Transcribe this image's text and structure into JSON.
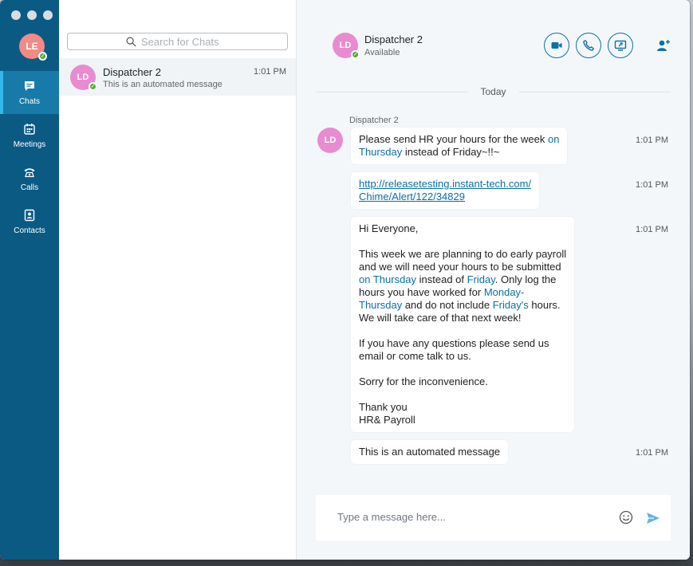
{
  "colors": {
    "rail": "#0a5a84",
    "rail_active": "#187aa8",
    "accent": "#0b72a3",
    "link": "#0b6fa4",
    "presence": "#4caf2f"
  },
  "me": {
    "initials": "LE"
  },
  "nav": {
    "items": [
      {
        "label": "Chats",
        "icon": "chat-icon"
      },
      {
        "label": "Meetings",
        "icon": "calendar-icon"
      },
      {
        "label": "Calls",
        "icon": "phone-icon"
      },
      {
        "label": "Contacts",
        "icon": "contacts-icon"
      }
    ]
  },
  "search": {
    "placeholder": "Search for Chats",
    "icon": "search-icon"
  },
  "chat_list": [
    {
      "initials": "LD",
      "name": "Dispatcher 2",
      "preview": "This is an automated message",
      "time": "1:01 PM"
    }
  ],
  "conversation": {
    "initials": "LD",
    "name": "Dispatcher 2",
    "status": "Available",
    "actions": [
      "video-icon",
      "phone-icon",
      "screen-share-icon",
      "add-person-icon"
    ],
    "date_divider": "Today",
    "sender": "Dispatcher 2",
    "messages": [
      {
        "time": "1:01 PM",
        "line1_a": "Please send HR your hours for the week ",
        "line1_b": "on",
        "line2_a": "Thursday",
        "line2_b": " instead of Friday~!!~"
      },
      {
        "time": "1:01 PM",
        "link_line1": "http://releasetesting.instant-tech.com/",
        "link_line2": "Chime/Alert/122/34829"
      },
      {
        "time": "1:01 PM",
        "greeting": "Hi Everyone,",
        "p1_l1": "This week we are planning to do early payroll",
        "p1_l2": "and we will need your hours to be submitted",
        "p1_l3a": "on Thursday",
        "p1_l3b": " instead of ",
        "p1_l3c": "Friday",
        "p1_l3d": ". Only log the",
        "p1_l4a": "hours you have worked for ",
        "p1_l4b": "Monday-",
        "p1_l5a": "Thursday",
        "p1_l5b": " and do not include ",
        "p1_l5c": "Friday's",
        "p1_l5d": " hours.",
        "p1_l6": "We will take care of that next week!",
        "p2_l1": "If you have any questions please send us",
        "p2_l2": "email or come talk to us.",
        "p3": "Sorry for the inconvenience.",
        "sign1": "Thank you",
        "sign2": "HR& Payroll"
      },
      {
        "time": "1:01 PM",
        "text": "This is an automated message"
      }
    ]
  },
  "composer": {
    "placeholder": "Type a message here...",
    "emoji_icon": "emoji-icon",
    "send_icon": "send-icon"
  }
}
